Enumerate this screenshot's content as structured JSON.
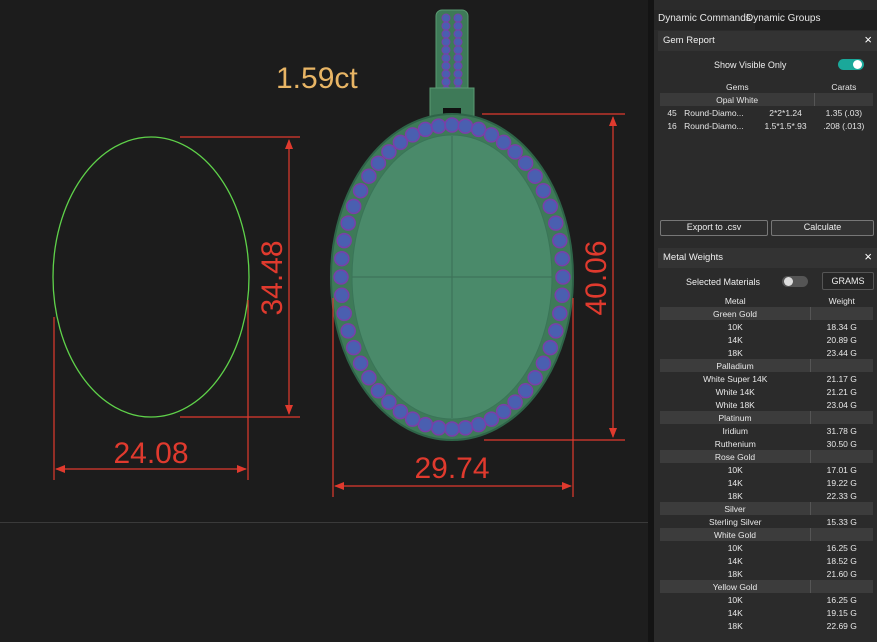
{
  "viewport": {
    "carat_label": "1.59ct",
    "dimensions": {
      "outline_width": "24.08",
      "outline_height": "34.48",
      "pendant_width": "29.74",
      "pendant_height": "40.06"
    },
    "colors": {
      "dimension": "#e03a2e",
      "outline": "#5fd24a",
      "carat_text": "#e8b565",
      "metal": "#3e7a58",
      "gem": "#4a5fb0"
    }
  },
  "tabs": [
    "Dynamic Commands",
    "Dynamic Groups"
  ],
  "gem_report": {
    "title": "Gem Report",
    "show_visible_only_label": "Show Visible Only",
    "show_visible_only": true,
    "columns": [
      "Gems",
      "Carats"
    ],
    "group": "Opal White",
    "rows": [
      {
        "count": "45",
        "shape": "Round-Diamo...",
        "size": "2*2*1.24",
        "carats": "1.35 (.03)"
      },
      {
        "count": "16",
        "shape": "Round-Diamo...",
        "size": "1.5*1.5*.93",
        "carats": ".208 (.013)"
      }
    ],
    "export_label": "Export to .csv",
    "calculate_label": "Calculate"
  },
  "metal_weights": {
    "title": "Metal Weights",
    "selected_materials_label": "Selected Materials",
    "selected_materials": false,
    "unit_button": "GRAMS",
    "columns": [
      "Metal",
      "Weight"
    ],
    "groups": [
      {
        "name": "Green Gold",
        "items": [
          [
            "10K",
            "18.34 G"
          ],
          [
            "14K",
            "20.89 G"
          ],
          [
            "18K",
            "23.44 G"
          ]
        ]
      },
      {
        "name": "Palladium",
        "items": [
          [
            "White Super 14K",
            "21.17 G"
          ],
          [
            "White 14K",
            "21.21 G"
          ],
          [
            "White 18K",
            "23.04 G"
          ]
        ]
      },
      {
        "name": "Platinum",
        "items": [
          [
            "Iridium",
            "31.78 G"
          ],
          [
            "Ruthenium",
            "30.50 G"
          ]
        ]
      },
      {
        "name": "Rose Gold",
        "items": [
          [
            "10K",
            "17.01 G"
          ],
          [
            "14K",
            "19.22 G"
          ],
          [
            "18K",
            "22.33 G"
          ]
        ]
      },
      {
        "name": "Silver",
        "items": [
          [
            "Sterling Silver",
            "15.33 G"
          ]
        ]
      },
      {
        "name": "White Gold",
        "items": [
          [
            "10K",
            "16.25 G"
          ],
          [
            "14K",
            "18.52 G"
          ],
          [
            "18K",
            "21.60 G"
          ]
        ]
      },
      {
        "name": "Yellow Gold",
        "items": [
          [
            "10K",
            "16.25 G"
          ],
          [
            "14K",
            "19.15 G"
          ],
          [
            "18K",
            "22.69 G"
          ]
        ]
      }
    ]
  }
}
